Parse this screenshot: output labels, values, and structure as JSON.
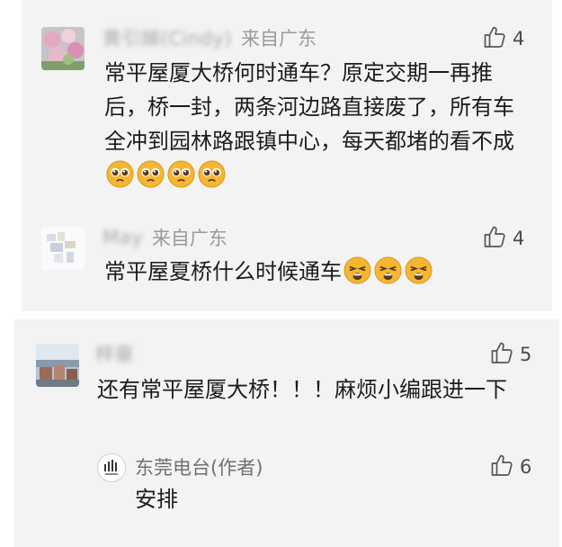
{
  "comments": [
    {
      "nickname": "黄引娣(Cindy)",
      "location": "来自广东",
      "likes": "4",
      "text": "常平屋厦大桥何时通车？原定交期一再推后，桥一封，两条河边路直接废了，所有车全冲到园林路跟镇中心，每天都堵的看不成",
      "emoji_count": 4,
      "emoji_name": "pleading-face-emoji"
    },
    {
      "nickname": "May",
      "location": "来自广东",
      "likes": "4",
      "text": "常平屋夏桥什么时候通车",
      "emoji_count": 3,
      "emoji_name": "tired-face-emoji"
    },
    {
      "nickname": "梓豪",
      "likes": "5",
      "text": "还有常平屋厦大桥！！！麻烦小编跟进一下",
      "reply": {
        "author": "东莞电台(作者)",
        "likes": "6",
        "text": "安排"
      }
    }
  ],
  "colors": {
    "card_bg": "#f3f3f3",
    "text": "#1c1c1c",
    "muted": "#9a9a9a",
    "emoji": "#f5b731"
  }
}
